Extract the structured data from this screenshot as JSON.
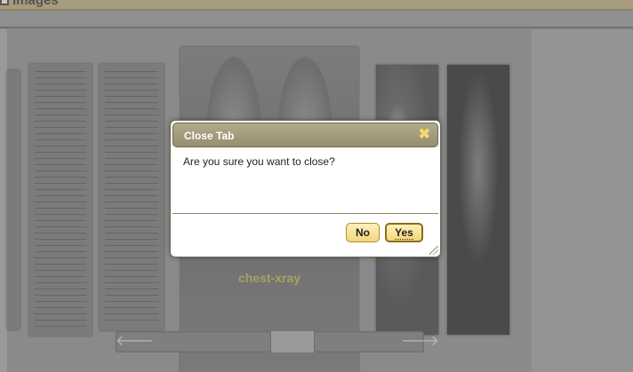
{
  "header": {
    "title": "Images",
    "icon": "image-icon"
  },
  "viewer": {
    "caption": "chest-xray",
    "scroll_left_glyph": "🡐",
    "scroll_right_glyph": "🡒"
  },
  "dialog": {
    "title": "Close Tab",
    "close_glyph": "✖",
    "message": "Are you sure you want to close?",
    "no_label": "No",
    "yes_label": "Yes"
  },
  "colors": {
    "overlay": "#8e8e8e",
    "dialog_title_bg": "#a79f81",
    "button_bg": "#f5d67c",
    "close_icon": "#f5d86d",
    "caption_text": "#a7a162"
  }
}
